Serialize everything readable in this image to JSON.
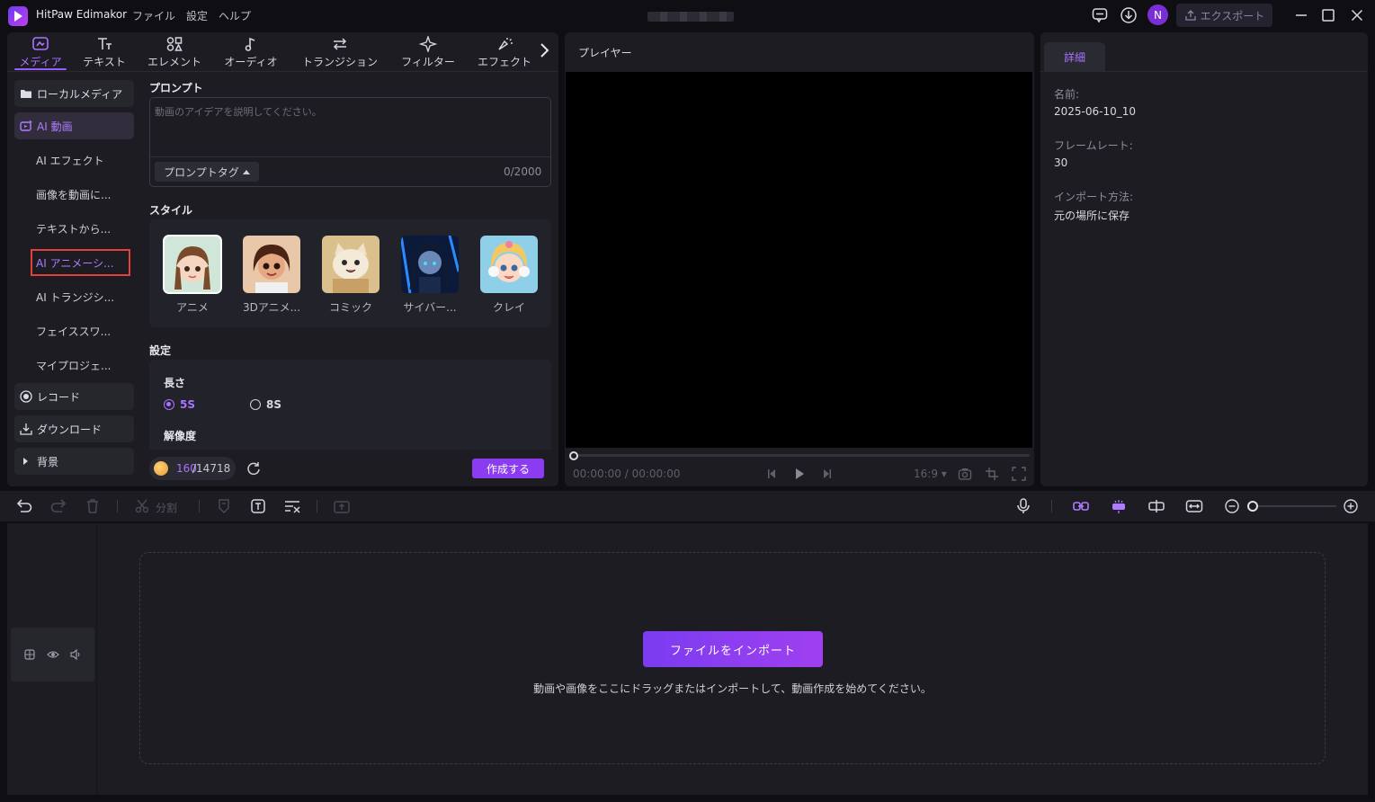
{
  "app": {
    "name": "HitPaw Edimakor",
    "menu": [
      "ファイル",
      "設定",
      "ヘルプ"
    ],
    "avatar_initial": "N",
    "export_label": "エクスポート"
  },
  "toolbar_tabs": [
    {
      "label": "メディア",
      "icon": "media-icon",
      "active": true
    },
    {
      "label": "テキスト",
      "icon": "text-icon"
    },
    {
      "label": "エレメント",
      "icon": "element-icon"
    },
    {
      "label": "オーディオ",
      "icon": "audio-icon"
    },
    {
      "label": "トランジション",
      "icon": "transition-icon"
    },
    {
      "label": "フィルター",
      "icon": "filter-icon"
    },
    {
      "label": "エフェクト",
      "icon": "effect-icon"
    }
  ],
  "sidebar": {
    "local_media": "ローカルメディア",
    "ai_video": "AI 動画",
    "sub_items": [
      "AI エフェクト",
      "画像を動画に...",
      "テキストから...",
      "AI アニメーシ...",
      "AI トランジシ...",
      "フェイススワ...",
      "マイプロジェ..."
    ],
    "record": "レコード",
    "download": "ダウンロード",
    "background": "背景"
  },
  "prompt": {
    "title": "プロンプト",
    "placeholder": "動画のアイデアを説明してください。",
    "tag_label": "プロンプトタグ",
    "counter": "0/2000"
  },
  "style": {
    "title": "スタイル",
    "items": [
      "アニメ",
      "3Dアニメ...",
      "コミック",
      "サイバー...",
      "クレイ"
    ],
    "selected": "アニメ"
  },
  "settings": {
    "title": "設定",
    "length_label": "長さ",
    "length_options": [
      "5S",
      "8S"
    ],
    "length_selected": "5S",
    "resolution_label": "解像度"
  },
  "credits": {
    "used": "160",
    "total": "/14718"
  },
  "create_label": "作成する",
  "player": {
    "title": "プレイヤー",
    "timecode": "00:00:00 / 00:00:00",
    "ratio": "16:9"
  },
  "details": {
    "tab": "詳細",
    "name_label": "名前:",
    "name_value": "2025-06-10_10",
    "framerate_label": "フレームレート:",
    "framerate_value": "30",
    "import_label": "インポート方法:",
    "import_value": "元の場所に保存"
  },
  "timeline": {
    "split_label": "分割",
    "import_button": "ファイルをインポート",
    "hint": "動画や画像をここにドラッグまたはインポートして、動画作成を始めてください。"
  },
  "colors": {
    "accent": "#9a5cff",
    "button": "#8b3cf0",
    "highlight_border": "#e2403a"
  }
}
